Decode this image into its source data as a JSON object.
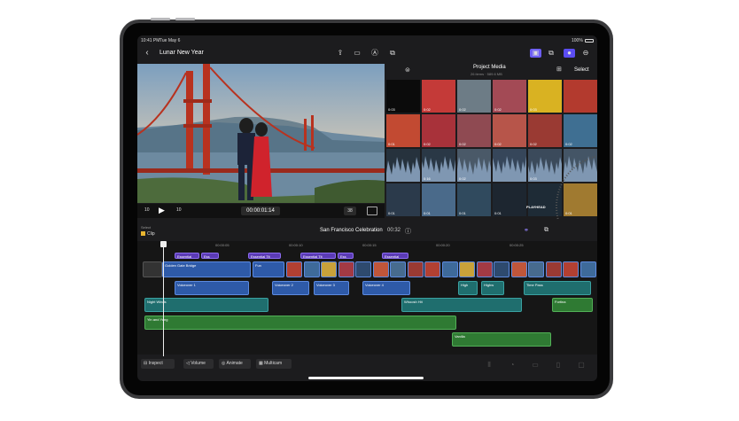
{
  "status": {
    "time": "10:41 PM",
    "date": "Tue May 6",
    "battery": "100%"
  },
  "header": {
    "project_title": "Lunar New Year",
    "icons": [
      "back-chevron-icon",
      "share-icon",
      "camera-icon",
      "voiceover-icon",
      "export-icon",
      "photos-icon",
      "copy-icon",
      "record-icon",
      "more-icon"
    ]
  },
  "media": {
    "title": "Project Media",
    "subtitle": "26 items · 589.6 MB",
    "select_label": "Select",
    "thumbs": [
      {
        "dur": "0:03",
        "color": "#0b0b0b"
      },
      {
        "dur": "0:02",
        "color": "#c43a38"
      },
      {
        "dur": "0:02",
        "color": "#6d7c86"
      },
      {
        "dur": "0:02",
        "color": "#a34a55"
      },
      {
        "dur": "0:03",
        "color": "#d9b222"
      },
      {
        "dur": "",
        "color": "#b33a2e"
      },
      {
        "dur": "0:01",
        "color": "#c24a32"
      },
      {
        "dur": "0:02",
        "color": "#a8323a"
      },
      {
        "dur": "0:02",
        "color": "#8f4a52"
      },
      {
        "dur": "0:02",
        "color": "#b7554a"
      },
      {
        "dur": "0:02",
        "color": "#9a3a33"
      },
      {
        "dur": "0:02",
        "color": "#3f6f92"
      },
      {
        "dur": "",
        "color": "#26323d"
      },
      {
        "dur": "0:16",
        "color": "#2a3846"
      },
      {
        "dur": "0:02",
        "color": "#4a5968"
      },
      {
        "dur": "",
        "color": "#36465a"
      },
      {
        "dur": "0:03",
        "color": "#3b4a5b"
      },
      {
        "dur": "",
        "color": "#445566"
      },
      {
        "dur": "0:01",
        "color": "#2b3a4b"
      },
      {
        "dur": "0:01",
        "color": "#4a6a8a"
      },
      {
        "dur": "0:01",
        "color": "#304a5e"
      },
      {
        "dur": "0:01",
        "color": "#1d2630"
      },
      {
        "dur": "",
        "color": "#1e2b36"
      },
      {
        "dur": "0:01",
        "color": "#a07a30"
      }
    ],
    "playhead_label": "PLAYHEAD"
  },
  "transport": {
    "rewind": "10",
    "forward": "10",
    "timecode": "00:00:01:14",
    "zoom": "38"
  },
  "timeline": {
    "select_label": "Select",
    "clip_label": "Clip",
    "project_name": "San Francisco Celebration",
    "duration": "00:32",
    "ruler": [
      "00:00:05",
      "00:00:10",
      "00:00:15",
      "00:00:20",
      "00:00:25"
    ]
  },
  "clips": {
    "titles": [
      "Essential",
      "Ess",
      "Essential Tit",
      "Essential Tit",
      "Ess",
      "Essential"
    ],
    "main": "Golden Gate Bridge",
    "main_short": "Fun",
    "voiceovers": [
      "Voiceover 1",
      "Voiceover 2",
      "Voiceover 3",
      "Voiceover 4",
      "High",
      "Highw",
      "Time Pass"
    ],
    "music1": "Night Winds",
    "music2": "Whoosh Hit",
    "music3": "Yin and Yang",
    "music4": "Vanilla",
    "music5": "Fortina"
  },
  "toolbar": {
    "inspect": "Inspect",
    "volume": "Volume",
    "animate": "Animate",
    "multicam": "Multicam"
  }
}
